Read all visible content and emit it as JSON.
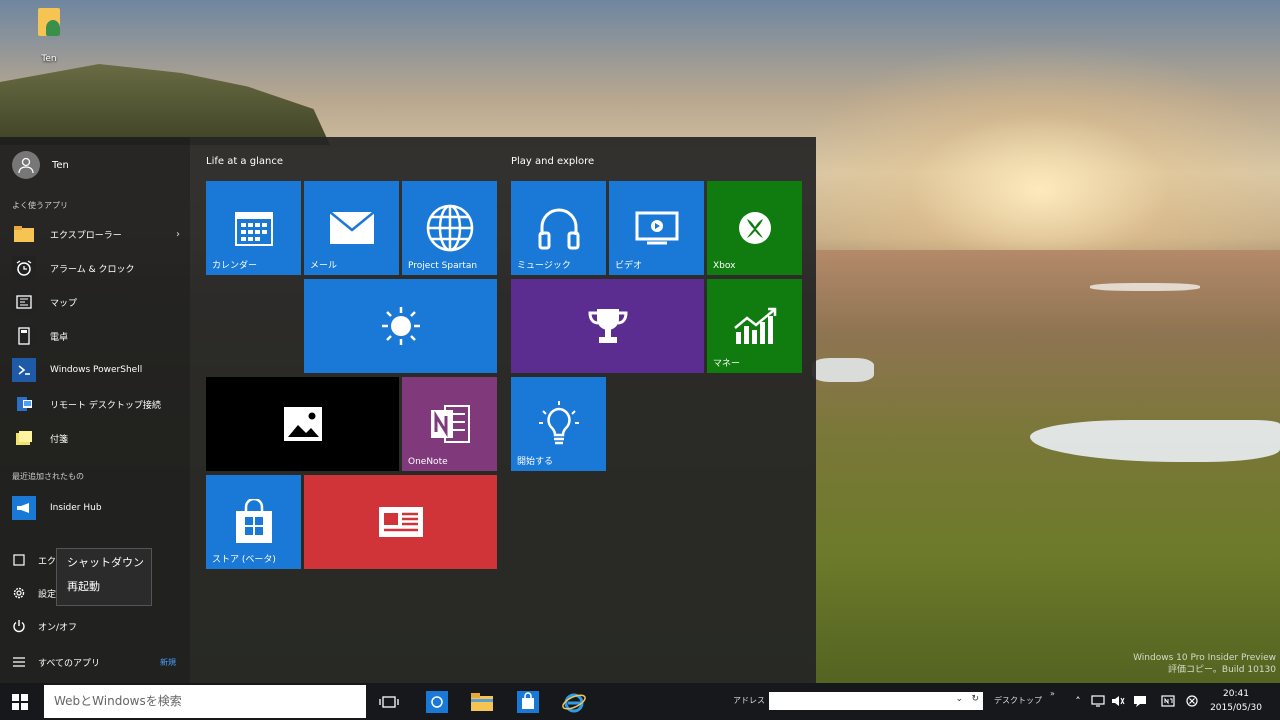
{
  "desktop": {
    "icon_label": "Ten",
    "watermark_line1": "Windows 10 Pro Insider Preview",
    "watermark_line2": "評価コピー。Build 10130"
  },
  "start": {
    "user_name": "Ten",
    "section_frequent": "よく使うアプリ",
    "apps": [
      {
        "label": "エクスプローラー"
      },
      {
        "label": "アラーム & クロック"
      },
      {
        "label": "マップ"
      },
      {
        "label": "電卓"
      },
      {
        "label": "Windows PowerShell"
      },
      {
        "label": "リモート デスクトップ接続"
      },
      {
        "label": "付箋"
      }
    ],
    "section_recent": "最近追加されたもの",
    "recent_app": "Insider Hub",
    "sys_explorer": "エクスプローラー",
    "sys_settings": "設定",
    "sys_power": "オン/オフ",
    "sys_allapps": "すべてのアプリ",
    "new_badge": "新規",
    "power_menu": {
      "shutdown": "シャットダウン",
      "restart": "再起動"
    },
    "group1_title": "Life at a glance",
    "group2_title": "Play and explore",
    "tiles": {
      "calendar": "カレンダー",
      "mail": "メール",
      "spartan": "Project Spartan",
      "music": "ミュージック",
      "video": "ビデオ",
      "xbox": "Xbox",
      "money": "マネー",
      "onenote": "OneNote",
      "getstarted": "開始する",
      "store": "ストア (ベータ)"
    }
  },
  "taskbar": {
    "search_placeholder": "WebとWindowsを検索",
    "address_label": "アドレス",
    "desktop_label": "デスクトップ",
    "time": "20:41",
    "date": "2015/05/30"
  },
  "colors": {
    "tile_blue": "#1a78d6",
    "xbox_green": "#107c10",
    "purple": "#5c2d91",
    "onenote": "#80397b",
    "red": "#d13438"
  }
}
